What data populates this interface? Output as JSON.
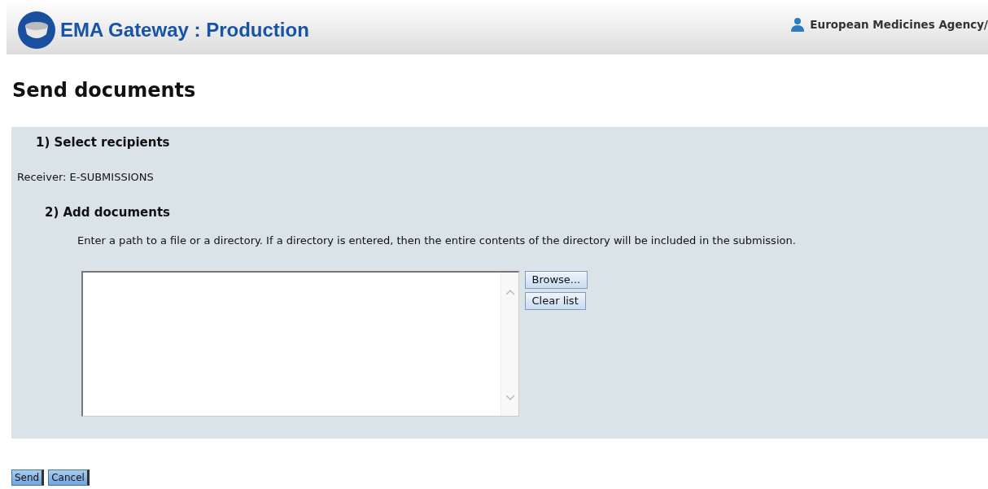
{
  "header": {
    "title": "EMA Gateway : Production",
    "user": "European Medicines Agency/"
  },
  "page_title": "Send documents",
  "sections": [
    {
      "heading": "1) Select recipients"
    },
    {
      "heading": "2) Add documents"
    }
  ],
  "receiver": "Receiver: E-SUBMISSIONS",
  "instructions": "Enter a path to a file or a directory. If a directory is entered, then the entire contents of the directory will be included in the submission.",
  "list_buttons": [
    "Browse...",
    "Clear list"
  ],
  "footer_buttons": [
    "Send",
    "Cancel"
  ]
}
